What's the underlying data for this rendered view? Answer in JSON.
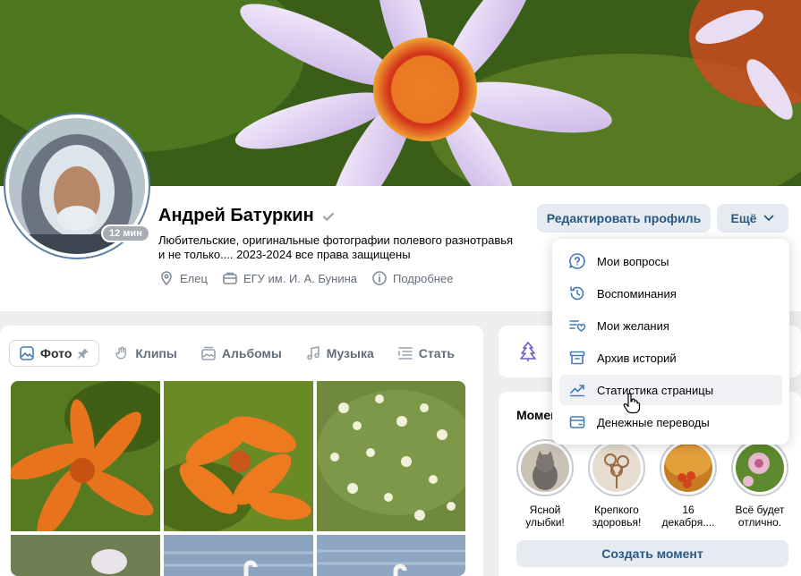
{
  "colors": {
    "accent": "#2a5885",
    "button_bg": "#e5ebf1",
    "muted": "#626d7a",
    "icon": "#447bba"
  },
  "profile": {
    "name": "Андрей Батуркин",
    "status_badge": "12 мин",
    "bio": "Любительские, оригинальные фотографии полевого разнотравья и не только.... 2023-2024 все права защищены",
    "meta": [
      {
        "icon": "location-icon",
        "label": "Елец"
      },
      {
        "icon": "briefcase-icon",
        "label": "ЕГУ им. И. А. Бунина"
      },
      {
        "icon": "info-icon",
        "label": "Подробнее"
      }
    ],
    "edit_button": "Редактировать профиль",
    "more_button": "Ещё"
  },
  "dropdown": {
    "items": [
      {
        "icon": "question-icon",
        "label": "Мои вопросы"
      },
      {
        "icon": "history-icon",
        "label": "Воспоминания"
      },
      {
        "icon": "wishlist-icon",
        "label": "Мои желания"
      },
      {
        "icon": "archive-icon",
        "label": "Архив историй"
      },
      {
        "icon": "stats-icon",
        "label": "Статистика страницы",
        "hovered": true
      },
      {
        "icon": "transfer-icon",
        "label": "Денежные переводы"
      }
    ]
  },
  "tabs": [
    {
      "icon": "photo-icon",
      "label": "Фото",
      "active": true
    },
    {
      "icon": "clips-icon",
      "label": "Клипы"
    },
    {
      "icon": "albums-icon",
      "label": "Альбомы"
    },
    {
      "icon": "music-icon",
      "label": "Музыка"
    },
    {
      "icon": "articles-icon",
      "label": "Стать"
    }
  ],
  "moments": {
    "title": "Момен",
    "items": [
      {
        "label": "Ясной улыбки!"
      },
      {
        "label": "Крепкого здоровья!"
      },
      {
        "label": "16 декабря...."
      },
      {
        "label": "Всё будет отлично."
      }
    ],
    "create_button": "Создать момент"
  }
}
